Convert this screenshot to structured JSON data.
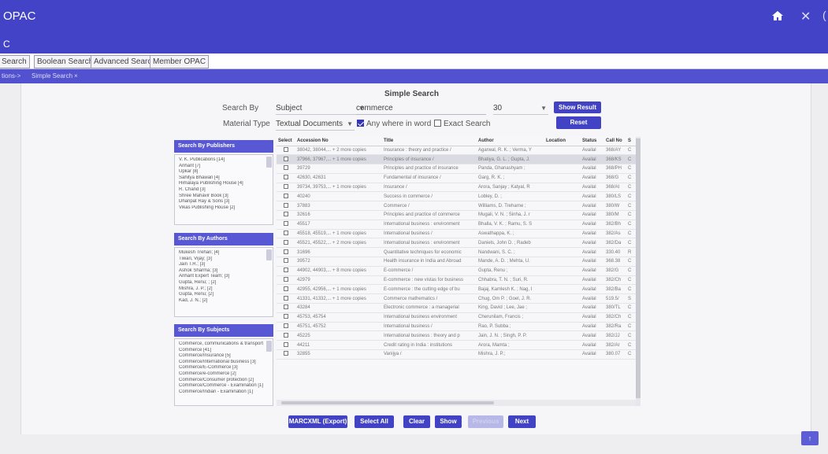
{
  "window": {
    "title": "OPAC",
    "icons": {
      "home": "home-icon",
      "close": "close-icon"
    }
  },
  "subheader": {
    "title": "C"
  },
  "tabs": [
    {
      "label": "Search"
    },
    {
      "label": "Boolean Search"
    },
    {
      "label": "Advanced Search"
    },
    {
      "label": "Member OPAC"
    }
  ],
  "breadcrumb": {
    "first": "tions->",
    "second": "Simple Search",
    "close": "×"
  },
  "search": {
    "title": "Simple Search",
    "search_by_label": "Search By",
    "search_by_value": "Subject",
    "query": "commerce",
    "count": "30",
    "material_type_label": "Material Type",
    "material_type_value": "Textual Documents",
    "any_where_label": "Any where in word",
    "any_where_checked": true,
    "exact_label": "Exact Search",
    "exact_checked": false,
    "show_result_label": "Show Result",
    "reset_label": "Reset"
  },
  "publishers": {
    "header": "Search By Publishers",
    "items": [
      "V. K. Publications [14]",
      "Arihant [7]",
      "Upkar [8]",
      "Sahitya Bhawan [4]",
      "Himalaya Publishing House [4]",
      "R. Chand [3]",
      "Shree Mahavir Book [3]",
      "Dhanpat Ray & Sons [3]",
      "Vikas Publishing House [2]"
    ]
  },
  "authors": {
    "header": "Search By Authors",
    "items": [
      "Mukesh Trehan; [4]",
      "Tiwari, Vijay; [3]",
      "Jain T.R.; [3]",
      "Ashok Sharma; [3]",
      "Arihant Expert Team; [3]",
      "Gupta, Renu; ; [2]",
      "Mishra, J. P.; [2]",
      "Gupta, Renu; [2]",
      "Kad, J. N.; [2]"
    ]
  },
  "subjects": {
    "header": "Search By Subjects",
    "items": [
      "Commerce, communications & transportation [1]",
      "Commerce [41]",
      "Commerce/Insurance [5]",
      "Commerce/International business [3]",
      "Commerce/E-Commerce [3]",
      "Commerce/e-commerce [2]",
      "Commerce/Consumer protection [2]",
      "Commerce/Commerce - Examination [1]",
      "Commerce/Indian - Examination [1]"
    ]
  },
  "results": {
    "columns": [
      "Select",
      "Accession No",
      "Title",
      "Author",
      "Location",
      "Status",
      "Call No",
      "S"
    ],
    "rows": [
      {
        "acc": "38042, 38044,... + 2 more copies",
        "title": "Insurance : theory and practice /",
        "author": "Agarwal, R. K. ; Verma, Y",
        "location": "",
        "status": "Availal",
        "call": "368/AY",
        "s": "C"
      },
      {
        "acc": "37966, 37967,... + 1 more copies",
        "title": "Principles of insurance /",
        "author": "Bhatiya, G. L. ; Gupta, J.",
        "location": "",
        "status": "Availal",
        "call": "368/KS",
        "s": "C"
      },
      {
        "acc": "39729",
        "title": "Principles and practice of insurance",
        "author": "Panda, Ghanashyam ;",
        "location": "",
        "status": "Availal",
        "call": "368/PH",
        "s": "C"
      },
      {
        "acc": "42630, 42631",
        "title": "Fundamental of insurance /",
        "author": "Garg, R. K. ;",
        "location": "",
        "status": "Availal",
        "call": "368/G",
        "s": "C"
      },
      {
        "acc": "39734, 39753,... + 1 more copies",
        "title": "Insurance /",
        "author": "Arora, Sanjay ; Katyal, R",
        "location": "",
        "status": "Availal",
        "call": "368/AI",
        "s": "C"
      },
      {
        "acc": "40240",
        "title": "Success in commerce /",
        "author": "Lobley, D. ;",
        "location": "",
        "status": "Availal",
        "call": "380/LS",
        "s": "C"
      },
      {
        "acc": "37883",
        "title": "Commerce /",
        "author": "Williams, D. Treharne ;",
        "location": "",
        "status": "Availal",
        "call": "380/W",
        "s": "C"
      },
      {
        "acc": "32616",
        "title": "Principles and practice of commerce",
        "author": "Mugali, V. N. ; Sinha, J. r",
        "location": "",
        "status": "Availal",
        "call": "380/M",
        "s": "C"
      },
      {
        "acc": "45517",
        "title": "International business : environment",
        "author": "Bhalla, V. K. ; Ramu, S. S",
        "location": "",
        "status": "Availal",
        "call": "382/Bh",
        "s": "C"
      },
      {
        "acc": "45518, 45519,... + 1 more copies",
        "title": "International business /",
        "author": "Aswathappa, K. ;",
        "location": "",
        "status": "Availal",
        "call": "382/As",
        "s": "C"
      },
      {
        "acc": "45521, 45522,... + 2 more copies",
        "title": "International business : environment",
        "author": "Daniels, John D. ; Radeb",
        "location": "",
        "status": "Availal",
        "call": "382/Da",
        "s": "C"
      },
      {
        "acc": "31696",
        "title": "Quantitative techniques for economic",
        "author": "Nandwani, S. C. ;",
        "location": "",
        "status": "Availal",
        "call": "330.40",
        "s": "R"
      },
      {
        "acc": "39572",
        "title": "Health insurance in India and Abroad",
        "author": "Mande, A. D. ; Mehta, U.",
        "location": "",
        "status": "Availal",
        "call": "368.38",
        "s": "C"
      },
      {
        "acc": "44902, 44903,... + 8 more copies",
        "title": "E-commerce /",
        "author": "Gupta, Renu ;",
        "location": "",
        "status": "Availal",
        "call": "382/G",
        "s": "C"
      },
      {
        "acc": "42979",
        "title": "E-commerce : new vistas for business",
        "author": "Chhabra, T. N. ; Suri, R.",
        "location": "",
        "status": "Availal",
        "call": "382/Ch",
        "s": "C"
      },
      {
        "acc": "42955, 42956,... + 1 more copies",
        "title": "E-commerce : the cutting edge of bu",
        "author": "Bajaj, Kamlesh K. ; Nag, I",
        "location": "",
        "status": "Availal",
        "call": "382/Ba",
        "s": "C"
      },
      {
        "acc": "41331, 41332,... + 1 more copies",
        "title": "Commerce mathematics /",
        "author": "Chug, Om P. ; Goel, J. R.",
        "location": "",
        "status": "Availal",
        "call": "519.5/",
        "s": "S"
      },
      {
        "acc": "43284",
        "title": "Electronic commerce : a managerial",
        "author": "King, David ; Lee, Jae ;",
        "location": "",
        "status": "Availal",
        "call": "380/TL",
        "s": "C"
      },
      {
        "acc": "45753, 45754",
        "title": "International business environment",
        "author": "Cherunilam, Francis ;",
        "location": "",
        "status": "Availal",
        "call": "382/Ch",
        "s": "C"
      },
      {
        "acc": "45751, 45752",
        "title": "International business /",
        "author": "Rao, P. Subba ;",
        "location": "",
        "status": "Availal",
        "call": "382/Ra",
        "s": "C"
      },
      {
        "acc": "45225",
        "title": "International business : theory and p",
        "author": "Jain, J. N. ; Singh, P. P.",
        "location": "",
        "status": "Availal",
        "call": "382/JJ",
        "s": "C"
      },
      {
        "acc": "44211",
        "title": "Credit rating in India : institutions",
        "author": "Arora, Mamta ;",
        "location": "",
        "status": "Availal",
        "call": "382/Ar",
        "s": "C"
      },
      {
        "acc": "32855",
        "title": "Vanijya /",
        "author": "Mishra, J. P.;",
        "location": "",
        "status": "Availal",
        "call": "380.07",
        "s": "C"
      }
    ]
  },
  "actions": {
    "marcxml": "MARCXML (Export)",
    "select_all": "Select All",
    "clear": "Clear",
    "show": "Show",
    "previous": "Previous",
    "next": "Next"
  },
  "scroll_top_icon": "arrow-up-icon",
  "scroll_top_glyph": "↑"
}
